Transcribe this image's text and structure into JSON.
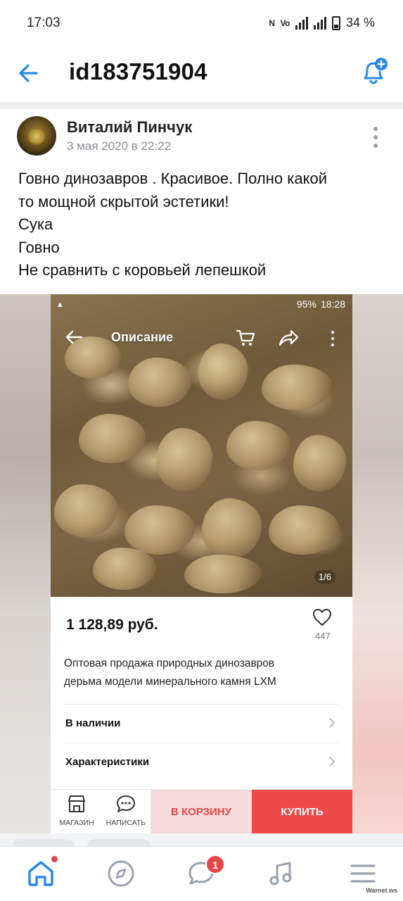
{
  "status_bar": {
    "time": "17:03",
    "battery": "34 %",
    "indicators": [
      "nfc-icon",
      "volte-icon",
      "4g-signal-icon",
      "signal-icon",
      "battery-icon"
    ]
  },
  "header": {
    "title": "id183751904",
    "back_icon": "arrow-left-icon",
    "bell_icon": "bell-plus-icon",
    "accent_color": "#2688eb"
  },
  "post": {
    "author": "Виталий Пинчук",
    "date": "3 мая 2020 в 22:22",
    "lines": [
      "Говно динозавров . Красивое. Полно какой",
      "то мощной скрытой эстетики!",
      "Сука",
      "Говно",
      "Не сравнить с коровьей лепешкой"
    ]
  },
  "embedded": {
    "status": {
      "time": "18:28",
      "battery": "95%"
    },
    "nav_title": "Описание",
    "pager": "1/6",
    "price": "1 128,89 руб.",
    "likes": "447",
    "description_lines": [
      "Оптовая продажа природных динозавров",
      "дерьма модели минерального камня LXM"
    ],
    "rows": [
      "В наличии",
      "Характеристики"
    ],
    "bottom": {
      "shop_label": "МАГАЗИН",
      "write_label": "НАПИСАТЬ",
      "cart_label": "В КОРЗИНУ",
      "buy_label": "КУПИТЬ"
    }
  },
  "bottom_nav": {
    "items": [
      "home-icon",
      "compass-icon",
      "messages-icon",
      "music-icon",
      "menu-icon"
    ],
    "messages_badge": "1"
  },
  "watermark": "Warnet.ws"
}
